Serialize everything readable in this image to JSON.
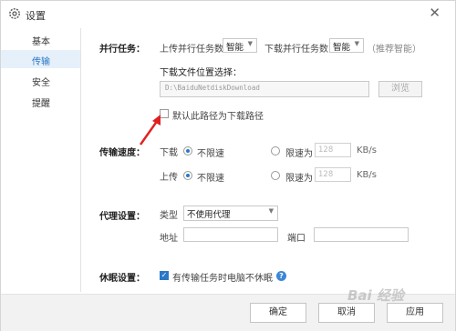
{
  "window": {
    "title": "设置",
    "close": "✕"
  },
  "sidebar": {
    "items": [
      {
        "label": "基本"
      },
      {
        "label": "传输"
      },
      {
        "label": "安全"
      },
      {
        "label": "提醒"
      }
    ]
  },
  "parallel": {
    "label": "并行任务：",
    "upload_label": "上传并行任务数",
    "upload_value": "智能",
    "download_label": "下载并行任务数",
    "download_value": "智能",
    "recommend": "（推荐智能）"
  },
  "download_path": {
    "label": "下载文件位置选择：",
    "value": "D:\\BaiduNetdiskDownload",
    "browse": "浏览",
    "default_checkbox": "默认此路径为下载路径"
  },
  "speed": {
    "label": "传输速度：",
    "download": "下载",
    "upload": "上传",
    "unlimited": "不限速",
    "limit": "限速为",
    "download_value": "128",
    "upload_value": "128",
    "unit": "KB/s"
  },
  "proxy": {
    "label": "代理设置：",
    "type_label": "类型",
    "type_value": "不使用代理",
    "address_label": "地址",
    "port_label": "端口"
  },
  "sleep": {
    "label": "休眠设置：",
    "checkbox": "有传输任务时电脑不休眠",
    "help": "?"
  },
  "footer": {
    "ok": "确定",
    "cancel": "取消",
    "apply": "应用"
  },
  "watermark": "Bai 经验"
}
